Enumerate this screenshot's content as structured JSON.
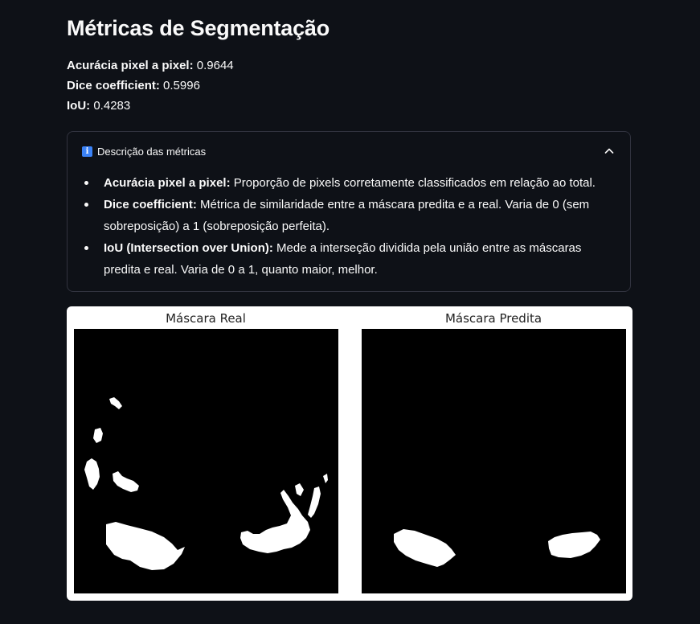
{
  "page": {
    "title": "Métricas de Segmentação"
  },
  "metrics": [
    {
      "label": "Acurácia pixel a pixel:",
      "value": "0.9644"
    },
    {
      "label": "Dice coefficient:",
      "value": "0.5996"
    },
    {
      "label": "IoU:",
      "value": "0.4283"
    }
  ],
  "expander": {
    "icon": "info-icon",
    "title": "Descrição das métricas",
    "expanded": true,
    "items": [
      {
        "term": "Acurácia pixel a pixel:",
        "text": "Proporção de pixels corretamente classificados em relação ao total."
      },
      {
        "term": "Dice coefficient:",
        "text": "Métrica de similaridade entre a máscara predita e a real. Varia de 0 (sem sobreposição) a 1 (sobreposição perfeita)."
      },
      {
        "term": "IoU (Intersection over Union):",
        "text": "Mede a interseção dividida pela união entre as máscaras predita e real. Varia de 0 a 1, quanto maior, melhor."
      }
    ]
  },
  "figure": {
    "panels": [
      {
        "title": "Máscara Real"
      },
      {
        "title": "Máscara Predita"
      }
    ]
  },
  "colors": {
    "background": "#0e1117",
    "text": "#fafafa",
    "border": "#31333f",
    "info_accent": "#3b82f6"
  }
}
